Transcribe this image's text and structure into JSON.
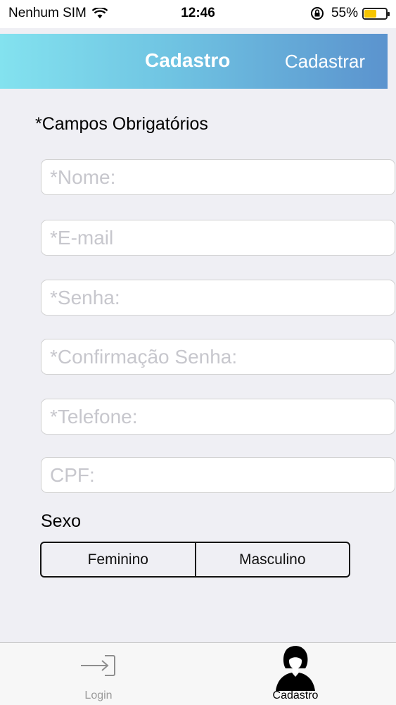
{
  "status_bar": {
    "carrier": "Nenhum SIM",
    "time": "12:46",
    "battery_percent": "55%",
    "battery_level": 0.55,
    "battery_color": "#f6c500"
  },
  "nav": {
    "title": "Cadastro",
    "action": "Cadastrar"
  },
  "form": {
    "required_note": "*Campos Obrigatórios",
    "fields": [
      {
        "placeholder": "*Nome:",
        "value": ""
      },
      {
        "placeholder": "*E-mail",
        "value": ""
      },
      {
        "placeholder": "*Senha:",
        "value": ""
      },
      {
        "placeholder": "*Confirmação Senha:",
        "value": ""
      },
      {
        "placeholder": "*Telefone:",
        "value": ""
      },
      {
        "placeholder": "CPF:",
        "value": ""
      }
    ],
    "sex_label": "Sexo",
    "sex_options": [
      "Feminino",
      "Masculino"
    ]
  },
  "tab_bar": {
    "items": [
      {
        "label": "Login",
        "icon": "login-arrow-icon",
        "selected": false
      },
      {
        "label": "Cadastro",
        "icon": "user-silhouette-icon",
        "selected": true
      }
    ]
  }
}
